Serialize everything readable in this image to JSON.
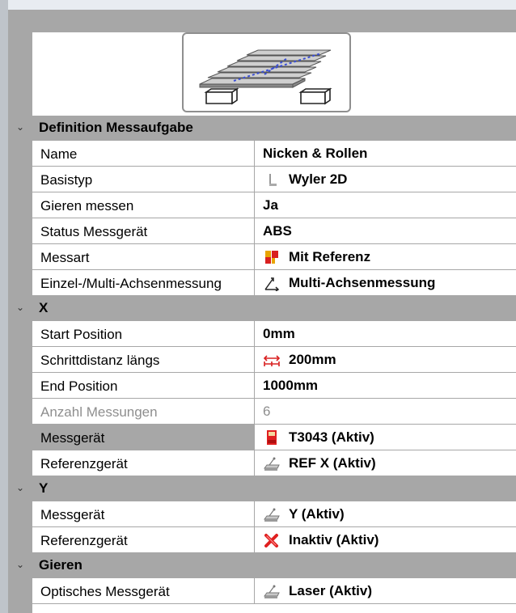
{
  "sections": [
    {
      "title": "Definition Messaufgabe",
      "rows": [
        {
          "label": "Name",
          "value": "Nicken & Rollen",
          "icon": ""
        },
        {
          "label": "Basistyp",
          "value": "Wyler 2D",
          "icon": "level-icon"
        },
        {
          "label": "Gieren messen",
          "value": "Ja",
          "icon": ""
        },
        {
          "label": "Status Messgerät",
          "value": "ABS",
          "icon": ""
        },
        {
          "label": "Messart",
          "value": "Mit Referenz",
          "icon": "reference-flag-icon"
        },
        {
          "label": "Einzel-/Multi-Achsenmessung",
          "value": "Multi-Achsenmessung",
          "icon": "multi-axis-icon"
        }
      ]
    },
    {
      "title": "X",
      "rows": [
        {
          "label": "Start Position",
          "value": "0mm",
          "icon": ""
        },
        {
          "label": "Schrittdistanz längs",
          "value": "200mm",
          "icon": "step-distance-icon"
        },
        {
          "label": "End Position",
          "value": "1000mm",
          "icon": ""
        },
        {
          "label": "Anzahl Messungen",
          "value": "6",
          "icon": ""
        },
        {
          "label": "Messgerät",
          "value": "T3043 (Aktiv)",
          "icon": "device-red-icon"
        },
        {
          "label": "Referenzgerät",
          "value": "REF X (Aktiv)",
          "icon": "device-gray-icon"
        }
      ]
    },
    {
      "title": "Y",
      "rows": [
        {
          "label": "Messgerät",
          "value": "Y (Aktiv)",
          "icon": "device-gray-icon"
        },
        {
          "label": "Referenzgerät",
          "value": "Inaktiv (Aktiv)",
          "icon": "red-x-icon"
        }
      ]
    },
    {
      "title": "Gieren",
      "rows": [
        {
          "label": "Optisches Messgerät",
          "value": "Laser (Aktiv)",
          "icon": "device-gray-icon"
        }
      ]
    }
  ],
  "preview": {
    "icon": "measurement-surface-preview-icon"
  }
}
